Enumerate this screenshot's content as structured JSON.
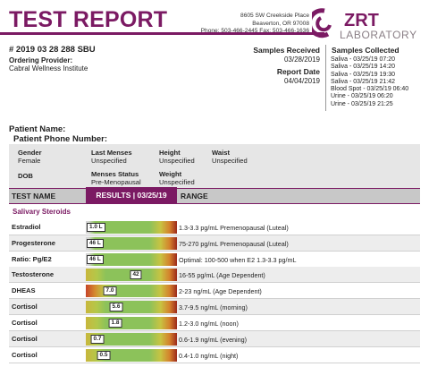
{
  "header": {
    "title": "TEST REPORT",
    "address_lines": [
      "8605 SW Creekside Place",
      "Beaverton, OR 97008",
      "Phone: 503-466-2445 Fax: 503-466-1636"
    ],
    "logo_zrt": "ZRT",
    "logo_lab": "LABORATORY"
  },
  "sample": {
    "id": "# 2019 03 28 288 SBU",
    "ordering_label": "Ordering Provider:",
    "ordering_value": "Cabral Wellness Institute",
    "received_label": "Samples Received",
    "received_value": "03/28/2019",
    "report_date_label": "Report Date",
    "report_date_value": "04/04/2019",
    "collected_label": "Samples Collected",
    "collected": [
      "Saliva - 03/25/19 07:20",
      "Saliva - 03/25/19 14:20",
      "Saliva - 03/25/19 19:30",
      "Saliva - 03/25/19 21:42",
      "Blood Spot - 03/25/19 06:40",
      "Urine - 03/25/19 06:20",
      "Urine - 03/25/19 21:25"
    ]
  },
  "patient": {
    "name_label": "Patient Name:",
    "phone_label": "Patient Phone Number:",
    "gender_label": "Gender",
    "gender_value": "Female",
    "dob_label": "DOB",
    "last_menses_label": "Last Menses",
    "last_menses_value": "Unspecified",
    "menses_status_label": "Menses Status",
    "menses_status_value": "Pre-Menopausal",
    "height_label": "Height",
    "height_value": "Unspecified",
    "weight_label": "Weight",
    "weight_value": "Unspecified",
    "waist_label": "Waist",
    "waist_value": "Unspecified"
  },
  "table": {
    "col_test": "TEST NAME",
    "col_results": "RESULTS | 03/25/19",
    "col_range": "RANGE",
    "section": "Salivary Steroids",
    "rows": [
      {
        "name": "Estradiol",
        "result": "1.0 L",
        "range": "1.3-3.3 pg/mL Premenopausal (Luteal)",
        "level": 0.0,
        "style": "left"
      },
      {
        "name": "Progesterone",
        "result": "46 L",
        "range": "75-270 pg/mL Premenopausal (Luteal)",
        "level": 0.0,
        "style": "left"
      },
      {
        "name": "Ratio: Pg/E2",
        "result": "46 L",
        "range": "Optimal: 100-500 when E2 1.3-3.3 pg/mL",
        "level": 0.0,
        "style": "left"
      },
      {
        "name": "Testosterone",
        "result": "42",
        "range": "16-55 pg/mL (Age Dependent)",
        "level": 0.55,
        "style": "center"
      },
      {
        "name": "DHEAS",
        "result": "7.0",
        "range": "2-23 ng/mL (Age Dependent)",
        "level": 0.26,
        "style": "center"
      },
      {
        "name": "Cortisol",
        "result": "5.6",
        "range": "3.7-9.5 ng/mL (morning)",
        "level": 0.33,
        "style": "center"
      },
      {
        "name": "Cortisol",
        "result": "1.8",
        "range": "1.2-3.0 ng/mL (noon)",
        "level": 0.32,
        "style": "center"
      },
      {
        "name": "Cortisol",
        "result": "0.7",
        "range": "0.6-1.9 ng/mL (evening)",
        "level": 0.13,
        "style": "center"
      },
      {
        "name": "Cortisol",
        "result": "0.5",
        "range": "0.4-1.0 ng/mL (night)",
        "level": 0.2,
        "style": "center"
      }
    ]
  },
  "colors": {
    "brand": "#7b1a63",
    "normal": "#8cc25a",
    "high": "#9c2a1b"
  }
}
